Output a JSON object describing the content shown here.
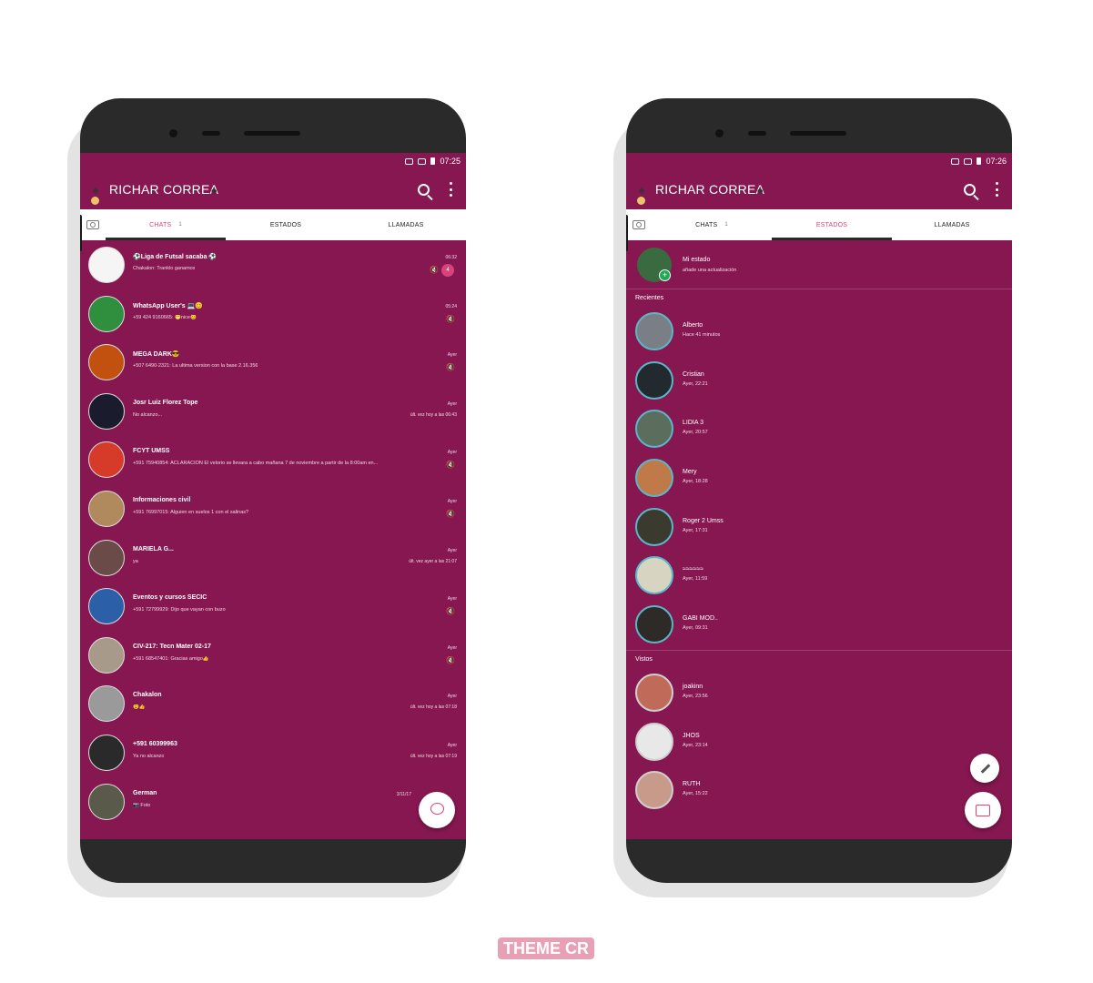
{
  "colors": {
    "primary": "#861751",
    "accent": "#d8437a",
    "tab_bg": "#ffffff",
    "story_ring": "#59b8c8"
  },
  "phone_left": {
    "statusbar": {
      "time": "07:25"
    },
    "appbar": {
      "title": "RICHAR CORREA",
      "icons": [
        "spade-icon",
        "search-icon",
        "more-vert-icon"
      ]
    },
    "tabs": [
      {
        "label": "CHATS",
        "count": "1"
      },
      {
        "label": "ESTADOS"
      },
      {
        "label": "LLAMADAS"
      }
    ],
    "chats": [
      {
        "name": "⚽Liga de Futsal sacaba ⚽",
        "message": "Chakalon: Tranklo ganamos",
        "time": "06:32",
        "unread": "4"
      },
      {
        "name": "WhatsApp User's 💻😊",
        "message": "+59 424 9160665: 😁nice😊",
        "time": "05:24"
      },
      {
        "name": "MEGA DARK😎",
        "message": "+507 6490-2321: La ultima version con la base 2.16.356",
        "time": "Ayer"
      },
      {
        "name": "Josr Luiz Florez Tope",
        "message": "No alcanzo...",
        "time": "Ayer",
        "last_seen": "últ. vez hoy a las 06:43"
      },
      {
        "name": "FCYT UMSS",
        "message": "+591 75940854: ACLARACIÓN El velorio se llevara a cabo mañana 7 de noviembre a partir de la 8:00am en...",
        "time": "Ayer"
      },
      {
        "name": "Informaciones civil",
        "message": "+591 76997015: Alguien en suelos 1 con el salinas?",
        "time": "Ayer"
      },
      {
        "name": "MARIELA G...",
        "message": "ya",
        "time": "Ayer",
        "last_seen": "últ. vez ayer a las 21:07"
      },
      {
        "name": "Eventos y cursos SECIC",
        "message": "+591 72799929: Dijo que vayan con buzo",
        "time": "Ayer"
      },
      {
        "name": "CIV-217: Tecn Mater 02-17",
        "message": "+591 68547401: Gracias amigo👍",
        "time": "Ayer"
      },
      {
        "name": "Chakalon",
        "message": "😉👍",
        "time": "Ayer",
        "last_seen": "últ. vez hoy a las 07:18"
      },
      {
        "name": "+591 60399963",
        "message": "Ya no alcanzo",
        "time": "Ayer",
        "last_seen": "últ. vez hoy a las 07:19"
      },
      {
        "name": "German",
        "message": "📷 Foto",
        "time": "3/11/17"
      }
    ]
  },
  "phone_right": {
    "statusbar": {
      "time": "07:26"
    },
    "appbar": {
      "title": "RICHAR CORREA"
    },
    "tabs": [
      {
        "label": "CHATS",
        "count": "1"
      },
      {
        "label": "ESTADOS"
      },
      {
        "label": "LLAMADAS"
      }
    ],
    "my_status": {
      "name": "Mi estado",
      "sub": "añade una actualización"
    },
    "recent_label": "Recientes",
    "recent": [
      {
        "name": "Alberto",
        "time": "Hace 41 minutos"
      },
      {
        "name": "Cristian",
        "time": "Ayer, 22:21"
      },
      {
        "name": "LIDIA 3",
        "time": "Ayer, 20:57"
      },
      {
        "name": "Mery",
        "time": "Ayer, 18:28"
      },
      {
        "name": "Roger 2 Umss",
        "time": "Ayer, 17:31"
      },
      {
        "name": "≈≈≈≈≈≈",
        "time": "Ayer, 11:59"
      },
      {
        "name": "GABI MOD..",
        "time": "Ayer, 09:31"
      }
    ],
    "viewed_label": "Vistos",
    "viewed": [
      {
        "name": "joakinn",
        "time": "Ayer, 23:56"
      },
      {
        "name": "JHOS",
        "time": "Ayer, 23:14"
      },
      {
        "name": "RUTH",
        "time": "Ayer, 15:22"
      }
    ]
  },
  "watermark": "THEME CR"
}
